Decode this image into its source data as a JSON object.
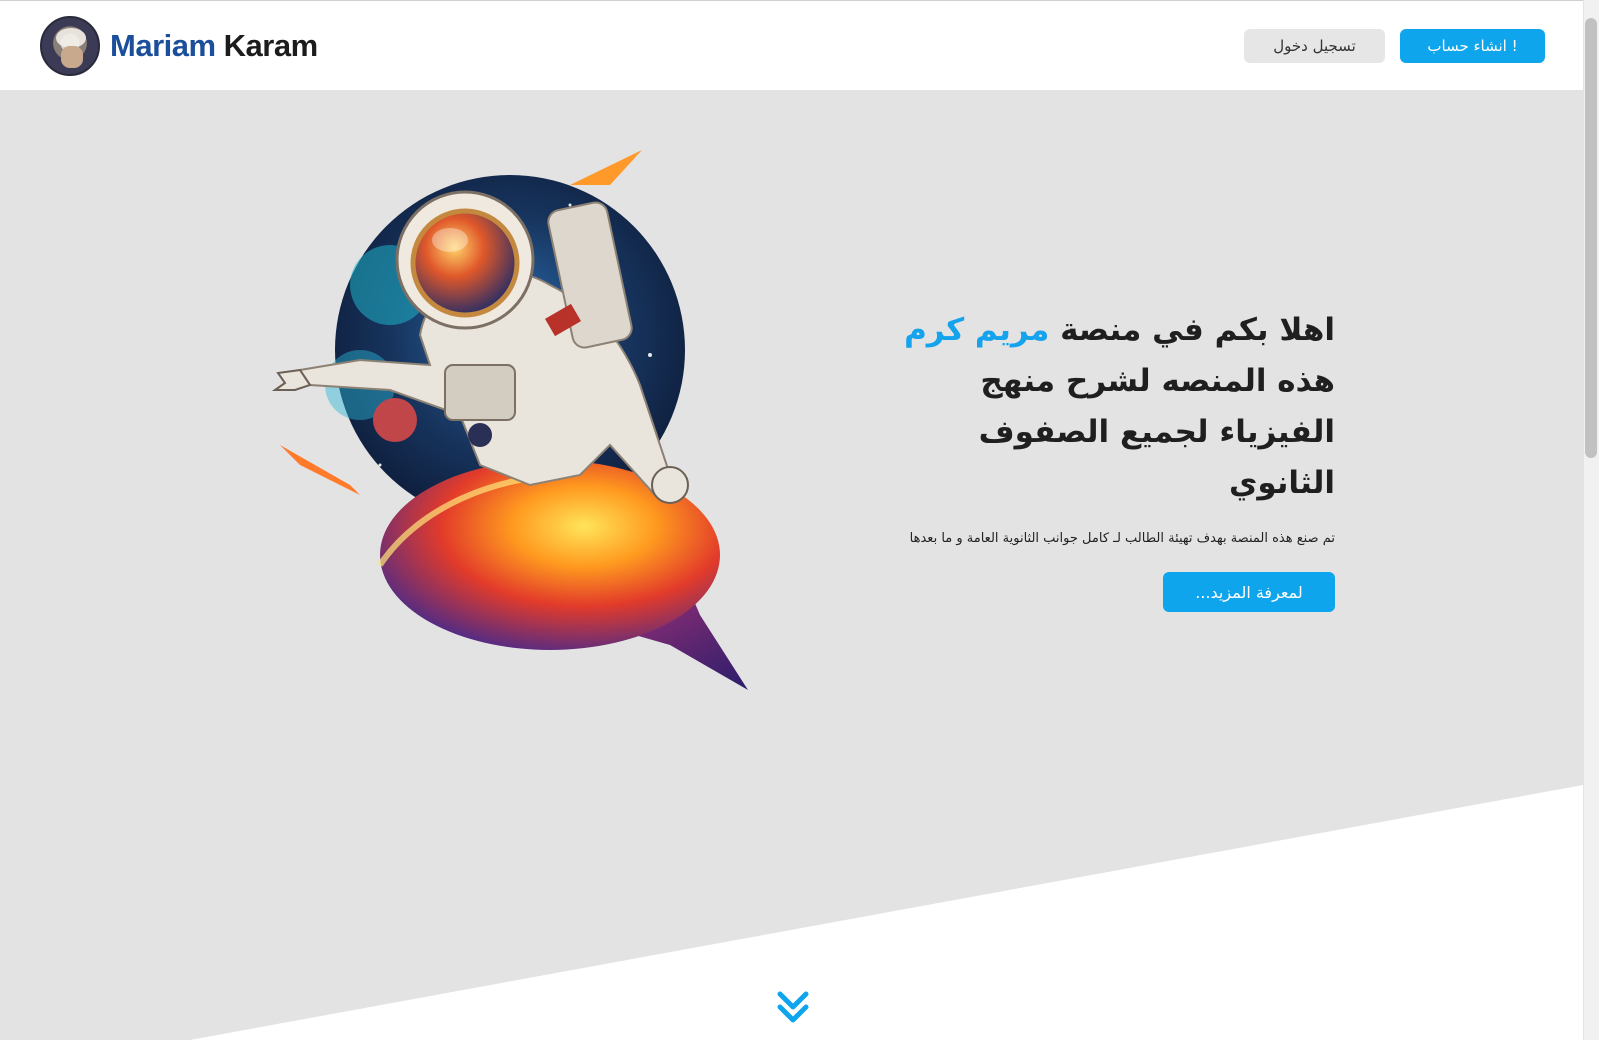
{
  "header": {
    "brand_first": "Mariam",
    "brand_last": "Karam",
    "login_label": "تسجيل دخول",
    "signup_label": "انشاء حساب !"
  },
  "hero": {
    "title_part1": "اهلا بكم في منصة",
    "title_highlight": "مريم كرم",
    "title_part2": "هذه المنصه لشرح منهج الفيزياء لجميع الصفوف الثانوي",
    "subtitle": "تم صنع هذه المنصة بهدف تهيئة الطالب لـ كامل جوانب الثانوية العامة و ما بعدها",
    "more_label": "لمعرفة المزيد..."
  },
  "colors": {
    "accent": "#0ea5ec",
    "brand_blue": "#1b4f9c",
    "hero_bg": "#e3e3e3"
  },
  "icons": {
    "scroll_down": "double-chevron-down-icon",
    "avatar": "avatar-portrait"
  }
}
